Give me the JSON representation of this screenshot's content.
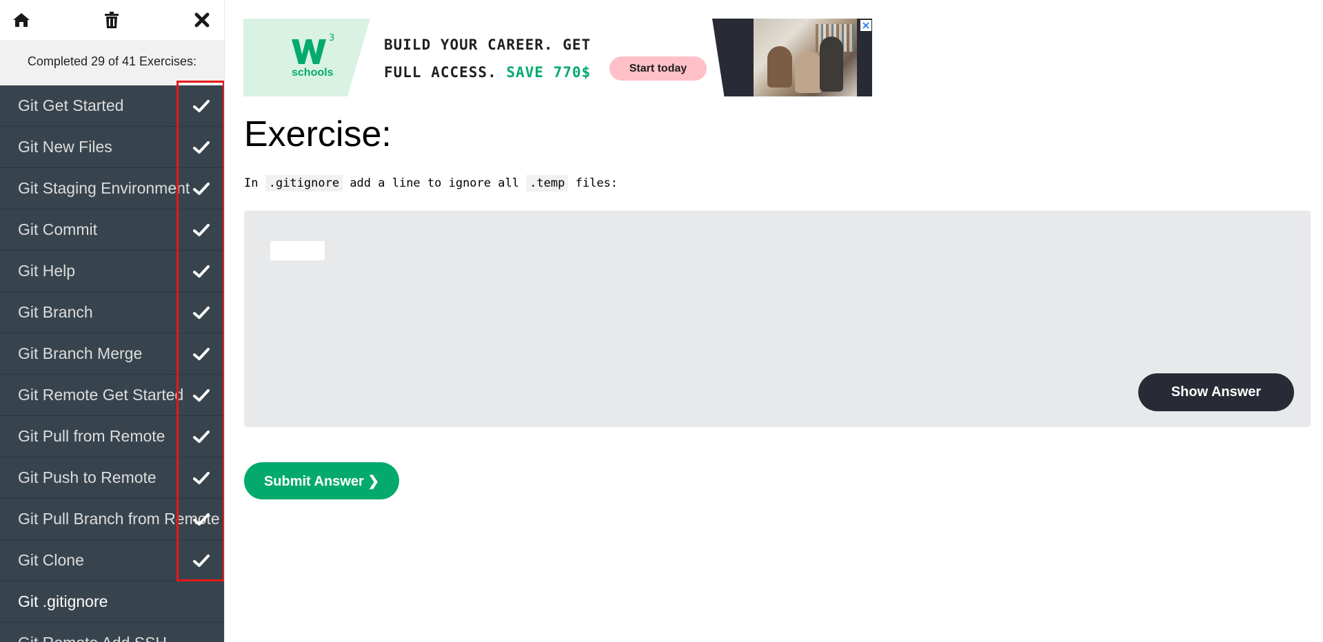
{
  "sidebar": {
    "progress_text": "Completed 29 of 41 Exercises:",
    "icons": [
      "home-icon",
      "trash-icon",
      "close-icon"
    ],
    "items": [
      {
        "label": "Git Get Started",
        "completed": true
      },
      {
        "label": "Git New Files",
        "completed": true
      },
      {
        "label": "Git Staging Environment",
        "completed": true
      },
      {
        "label": "Git Commit",
        "completed": true
      },
      {
        "label": "Git Help",
        "completed": true
      },
      {
        "label": "Git Branch",
        "completed": true
      },
      {
        "label": "Git Branch Merge",
        "completed": true
      },
      {
        "label": "Git Remote Get Started",
        "completed": true
      },
      {
        "label": "Git Pull from Remote",
        "completed": true
      },
      {
        "label": "Git Push to Remote",
        "completed": true
      },
      {
        "label": "Git Pull Branch from Remote",
        "completed": true
      },
      {
        "label": "Git Clone",
        "completed": true
      },
      {
        "label": "Git .gitignore",
        "completed": false,
        "active": true
      },
      {
        "label": "Git Remote Add SSH",
        "completed": false
      }
    ]
  },
  "ad": {
    "logo_text": "schools",
    "headline_line1": "BUILD YOUR CAREER. GET",
    "headline_line2_prefix": "FULL ACCESS. ",
    "headline_line2_highlight": "SAVE 770$",
    "cta_label": "Start today"
  },
  "exercise": {
    "title": "Exercise:",
    "instruction_prefix": "In ",
    "instruction_code1": ".gitignore",
    "instruction_middle": " add a line to ignore all ",
    "instruction_code2": ".temp",
    "instruction_suffix": " files:",
    "answer_value": "",
    "show_answer_label": "Show Answer",
    "submit_label": "Submit Answer ❯"
  },
  "colors": {
    "sidebar_item_bg": "#38444d",
    "accent_green": "#04aa6d",
    "dark_button": "#282a35",
    "highlight_border": "#e51717"
  }
}
